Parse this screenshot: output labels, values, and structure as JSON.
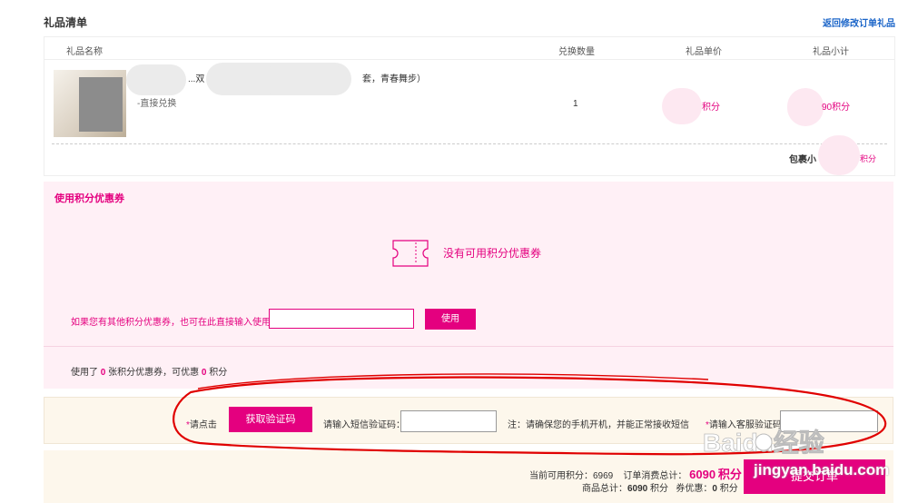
{
  "header": {
    "title": "礼品清单",
    "return_link": "返回修改订单礼品"
  },
  "table": {
    "columns": [
      "礼品名称",
      "兑换数量",
      "礼品单价",
      "礼品小计"
    ],
    "item": {
      "name_visible_prefix": "...双",
      "name_visible_suffix": "套，青春舞步）",
      "redeem_type": "-直接兑换",
      "quantity": "1",
      "unit_price_suffix": "积分",
      "subtotal_suffix": "90积分"
    },
    "shipping_label": "包裹小",
    "shipping_value_suffix": "积分"
  },
  "coupon": {
    "title": "使用积分优惠券",
    "empty_text": "没有可用积分优惠券",
    "other_coupon_label": "如果您有其他积分优惠券，也可在此直接输入使用",
    "coupon_input_placeholder": "",
    "use_button": "使用",
    "summary": {
      "prefix": "使用了",
      "count": "0",
      "middle": "张积分优惠券，可优惠",
      "discount": "0",
      "suffix": "积分"
    }
  },
  "verify": {
    "required_mark": "*",
    "click_label": "请点击",
    "get_code_button": "获取验证码",
    "sms_label": "请输入短信验证码：",
    "sms_value": "",
    "phone_note": "注：请确保您的手机开机，并能正常接收短信",
    "csr_label": "请输入客服验证码：",
    "csr_value": ""
  },
  "summary": {
    "available_label": "当前可用积分：",
    "available_value": "6969",
    "order_total_label": "订单消费总计：",
    "order_total_value": "6090",
    "order_total_unit": "积分",
    "goods_total_label": "商品总计：",
    "goods_total_value": "6090",
    "goods_total_unit": "积分",
    "coupon_discount_label": "券优惠：",
    "coupon_discount_value": "0",
    "coupon_discount_unit": "积分",
    "submit_button": "提交订单"
  },
  "watermark": {
    "text": "jingyan.baidu.com",
    "logo_text": "Baidu经验"
  },
  "colors": {
    "accent": "#e4007f",
    "link": "#1a64c8",
    "annotation": "#e00000"
  }
}
